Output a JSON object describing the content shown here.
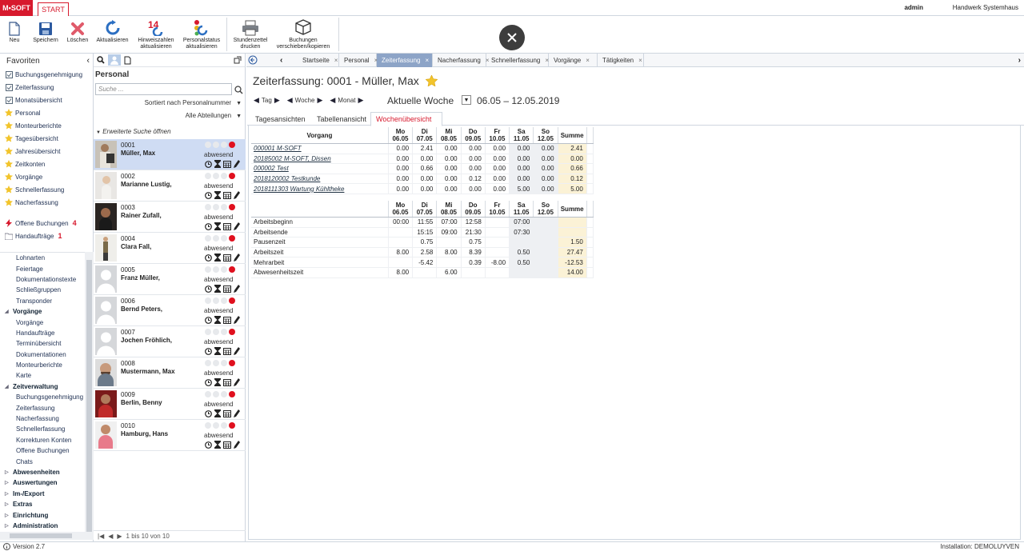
{
  "app": {
    "logo": "M•SOFT",
    "tab": "START",
    "user": "admin",
    "company": "Handwerk Systemhaus"
  },
  "ribbon": [
    {
      "label": "Neu",
      "icon": "new-document-icon"
    },
    {
      "label": "Speichern",
      "icon": "save-icon"
    },
    {
      "label": "Löschen",
      "icon": "delete-icon"
    },
    {
      "label": "Aktualisieren",
      "icon": "refresh-icon"
    },
    {
      "label": "Hinweiszahlen\naktualisieren",
      "icon": "hint-numbers-icon"
    },
    {
      "label": "Personalstatus\naktualisieren",
      "icon": "personnel-status-icon"
    },
    {
      "label": "Stundenzettel\ndrucken",
      "icon": "printer-icon"
    },
    {
      "label": "Buchungen\nverschieben/kopieren",
      "icon": "box-icon"
    }
  ],
  "favorites": {
    "title": "Favoriten",
    "items": [
      "Buchungsgenehmigung",
      "Zeiterfassung",
      "Monatsübersicht",
      "Personal",
      "Monteurberichte",
      "Tagesübersicht",
      "Jahresübersicht",
      "Zeitkonten",
      "Vorgänge",
      "Schnellerfassung",
      "Nacherfassung"
    ],
    "offene_buchungen": "Offene Buchungen",
    "offene_buchungen_count": "4",
    "handauftraege": "Handaufträge",
    "handauftraege_count": "1"
  },
  "tree": [
    {
      "t": "Lohnarten",
      "l": 2
    },
    {
      "t": "Feiertage",
      "l": 2
    },
    {
      "t": "Dokumentationstexte",
      "l": 2
    },
    {
      "t": "Schließgruppen",
      "l": 2
    },
    {
      "t": "Transponder",
      "l": 2
    },
    {
      "t": "Vorgänge",
      "l": 1,
      "open": true
    },
    {
      "t": "Vorgänge",
      "l": 2
    },
    {
      "t": "Handaufträge",
      "l": 2
    },
    {
      "t": "Terminübersicht",
      "l": 2
    },
    {
      "t": "Dokumentationen",
      "l": 2
    },
    {
      "t": "Monteurberichte",
      "l": 2
    },
    {
      "t": "Karte",
      "l": 2
    },
    {
      "t": "Zeitverwaltung",
      "l": 1,
      "open": true
    },
    {
      "t": "Buchungsgenehmigung",
      "l": 2
    },
    {
      "t": "Zeiterfassung",
      "l": 2
    },
    {
      "t": "Nacherfassung",
      "l": 2
    },
    {
      "t": "Schnellerfassung",
      "l": 2
    },
    {
      "t": "Korrekturen Konten",
      "l": 2
    },
    {
      "t": "Offene Buchungen",
      "l": 2
    },
    {
      "t": "Chats",
      "l": 2
    },
    {
      "t": "Abwesenheiten",
      "l": 1
    },
    {
      "t": "Auswertungen",
      "l": 1
    },
    {
      "t": "Im-/Export",
      "l": 1
    },
    {
      "t": "Extras",
      "l": 1
    },
    {
      "t": "Einrichtung",
      "l": 1
    },
    {
      "t": "Administration",
      "l": 1
    }
  ],
  "personal": {
    "title": "Personal",
    "search_placeholder": "Suche ...",
    "sort": "Sortiert nach Personalnummer",
    "dept": "Alle Abteilungen",
    "ext_search": "Erweiterte Suche öffnen",
    "status_label": "abwesend",
    "pager": "1 bis 10 von 10",
    "rows": [
      {
        "no": "0001",
        "name": "Müller, Max",
        "photo": "man-tablet",
        "sel": true
      },
      {
        "no": "0002",
        "name": "Marianne Lustig,",
        "photo": "woman-light"
      },
      {
        "no": "0003",
        "name": "Rainer Zufall,",
        "photo": "man-dark"
      },
      {
        "no": "0004",
        "name": "Clara Fall,",
        "photo": "woman-standing"
      },
      {
        "no": "0005",
        "name": "Franz Müller,",
        "photo": "placeholder"
      },
      {
        "no": "0006",
        "name": "Bernd Peters,",
        "photo": "placeholder"
      },
      {
        "no": "0007",
        "name": "Jochen Fröhlich,",
        "photo": "placeholder"
      },
      {
        "no": "0008",
        "name": "Mustermann, Max",
        "photo": "man-beard"
      },
      {
        "no": "0009",
        "name": "Berlin, Benny",
        "photo": "man-red"
      },
      {
        "no": "0010",
        "name": "Hamburg, Hans",
        "photo": "man-pink"
      }
    ]
  },
  "doc_tabs": [
    {
      "label": "Startseite"
    },
    {
      "label": "Personal"
    },
    {
      "label": "Zeiterfassung",
      "active": true
    },
    {
      "label": "Nacherfassung"
    },
    {
      "label": "Schnellerfassung"
    },
    {
      "label": "Vorgänge"
    },
    {
      "label": "Tätigkeiten"
    }
  ],
  "main": {
    "title": "Zeiterfassung: 0001 - Müller, Max",
    "nav_tag": "Tag",
    "nav_woche": "Woche",
    "nav_monat": "Monat",
    "current_week": "Aktuelle Woche",
    "date_range": "06.05 – 12.05.2019",
    "subtabs": [
      {
        "label": "Tagesansichten"
      },
      {
        "label": "Tabellenansicht"
      },
      {
        "label": "Wochenübersicht",
        "active": true
      }
    ],
    "days": [
      [
        "Mo",
        "06.05"
      ],
      [
        "Di",
        "07.05"
      ],
      [
        "Mi",
        "08.05"
      ],
      [
        "Do",
        "09.05"
      ],
      [
        "Fr",
        "10.05"
      ],
      [
        "Sa",
        "11.05"
      ],
      [
        "So",
        "12.05"
      ]
    ],
    "vorgang_header": "Vorgang",
    "sum_header": "Summe",
    "vorgaenge": [
      {
        "name": "000001 M-SOFT",
        "v": [
          "0.00",
          "2.41",
          "0.00",
          "0.00",
          "0.00",
          "0.00",
          "0.00"
        ],
        "sum": "2.41"
      },
      {
        "name": "20185002 M-SOFT, Dissen",
        "v": [
          "0.00",
          "0.00",
          "0.00",
          "0.00",
          "0.00",
          "0.00",
          "0.00"
        ],
        "sum": "0.00"
      },
      {
        "name": "000002 Test",
        "v": [
          "0.00",
          "0.66",
          "0.00",
          "0.00",
          "0.00",
          "0.00",
          "0.00"
        ],
        "sum": "0.66"
      },
      {
        "name": "2018120002 Testkunde",
        "v": [
          "0.00",
          "0.00",
          "0.00",
          "0.12",
          "0.00",
          "0.00",
          "0.00"
        ],
        "sum": "0.12"
      },
      {
        "name": "2018111303 Wartung Kühltheke",
        "v": [
          "0.00",
          "0.00",
          "0.00",
          "0.00",
          "0.00",
          "5.00",
          "0.00"
        ],
        "sum": "5.00"
      }
    ],
    "zeiten": [
      {
        "name": "Arbeitsbeginn",
        "v": [
          "00:00",
          "11:55",
          "07:00",
          "12:58",
          "",
          "07:00",
          ""
        ],
        "sum": ""
      },
      {
        "name": "Arbeitsende",
        "v": [
          "",
          "15:15",
          "09:00",
          "21:30",
          "",
          "07:30",
          ""
        ],
        "sum": ""
      },
      {
        "name": "Pausenzeit",
        "v": [
          "",
          "0.75",
          "",
          "0.75",
          "",
          "",
          ""
        ],
        "sum": "1.50"
      },
      {
        "name": "Arbeitszeit",
        "v": [
          "8.00",
          "2.58",
          "8.00",
          "8.39",
          "",
          "0.50",
          ""
        ],
        "sum": "27.47"
      },
      {
        "name": "Mehrarbeit",
        "v": [
          "",
          "-5.42",
          "",
          "0.39",
          "-8.00",
          "0.50",
          ""
        ],
        "sum": "-12.53"
      },
      {
        "name": "Abwesenheitszeit",
        "v": [
          "8.00",
          "",
          "6.00",
          "",
          "",
          "",
          ""
        ],
        "sum": "14.00"
      }
    ]
  },
  "status": {
    "version": "Version 2.7",
    "installation": "Installation: DEMOLUYVEN"
  }
}
